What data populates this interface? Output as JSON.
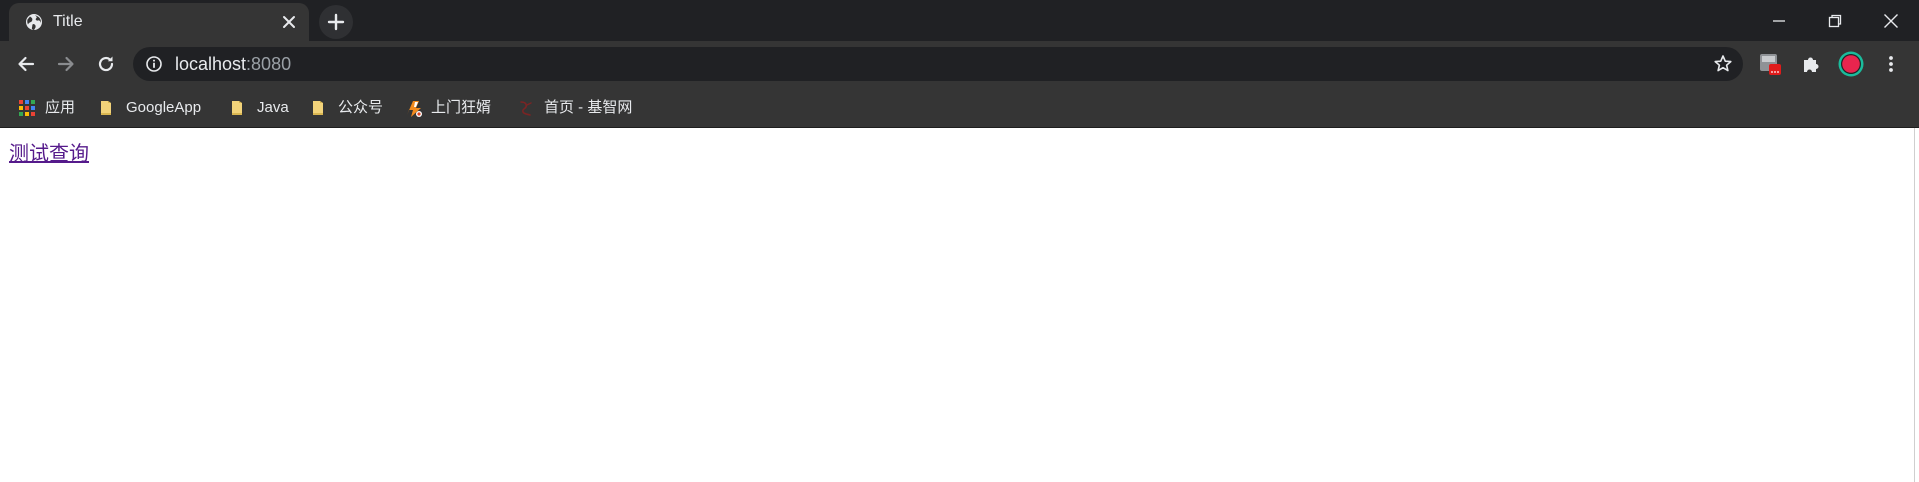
{
  "tab": {
    "title": "Title",
    "favicon": "globe-icon"
  },
  "toolbar": {
    "url_host": "localhost",
    "url_port": ":8080"
  },
  "bookmarks": [
    {
      "label": "应用",
      "icon": "apps-grid-icon"
    },
    {
      "label": "GoogleApp",
      "icon": "folder-icon"
    },
    {
      "label": "Java",
      "icon": "folder-icon"
    },
    {
      "label": "公众号",
      "icon": "folder-icon"
    },
    {
      "label": "上门狂婿",
      "icon": "site-favicon-icon"
    },
    {
      "label": "首页 - 基智网",
      "icon": "site-favicon-icon"
    }
  ],
  "page": {
    "link_text": "测试查询"
  },
  "colors": {
    "tabstrip": "#202124",
    "toolbar": "#353535",
    "omnibox": "#202124",
    "visited_link": "#551a8b",
    "folder": "#f2d37a",
    "avatar_ring": "#1abc9c",
    "avatar_fill": "#e8254e",
    "extension_badge": "#e01b1b"
  }
}
